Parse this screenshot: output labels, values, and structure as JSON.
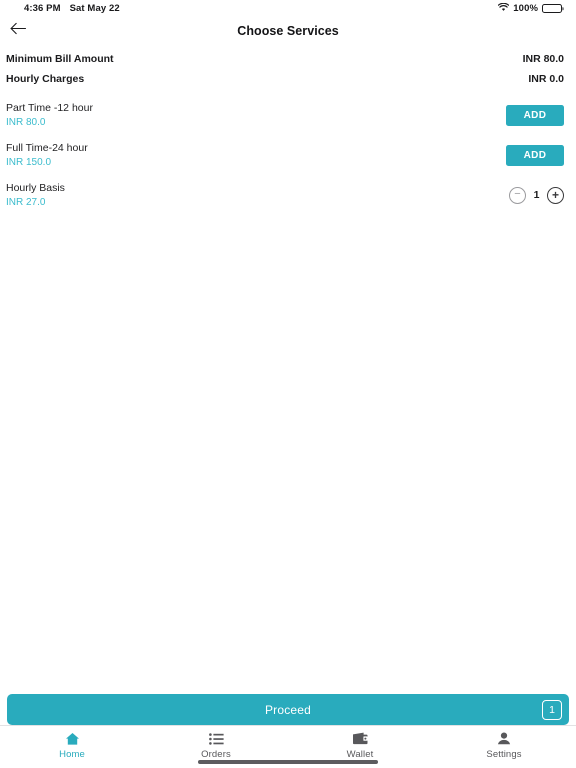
{
  "status_bar": {
    "time": "4:36 PM",
    "date": "Sat May 22",
    "wifi_icon": "wifi-icon",
    "battery_percent": "100%",
    "battery_icon": "battery-full-icon"
  },
  "header": {
    "back_icon": "back-arrow-icon",
    "title": "Choose Services"
  },
  "summary": [
    {
      "label": "Minimum Bill Amount",
      "value": "INR 80.0"
    },
    {
      "label": "Hourly Charges",
      "value": "INR 0.0"
    }
  ],
  "services": [
    {
      "name": "Part Time -12 hour",
      "price": "INR 80.0",
      "action": "add",
      "add_label": "ADD"
    },
    {
      "name": "Full Time-24 hour",
      "price": "INR 150.0",
      "action": "add",
      "add_label": "ADD"
    },
    {
      "name": "Hourly Basis",
      "price": "INR 27.0",
      "action": "stepper",
      "quantity": "1",
      "minus_label": "−",
      "plus_label": "+"
    }
  ],
  "proceed": {
    "label": "Proceed",
    "badge_count": "1"
  },
  "tabs": [
    {
      "label": "Home",
      "icon": "home-icon",
      "active": true
    },
    {
      "label": "Orders",
      "icon": "list-icon",
      "active": false
    },
    {
      "label": "Wallet",
      "icon": "wallet-icon",
      "active": false
    },
    {
      "label": "Settings",
      "icon": "person-icon",
      "active": false
    }
  ],
  "colors": {
    "accent": "#29abbd",
    "price_text": "#3bbccd",
    "tab_inactive": "#58585b"
  }
}
